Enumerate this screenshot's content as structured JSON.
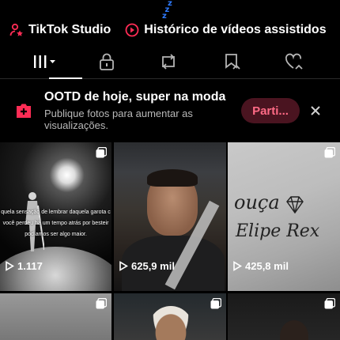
{
  "status": {
    "sleep_glyph": "zzz"
  },
  "shortcuts": [
    {
      "label": "TikTok Studio",
      "icon": "person-star-icon",
      "color": "#fe2c55"
    },
    {
      "label": "Histórico de vídeos assistidos",
      "icon": "play-circle-icon",
      "color": "#fe2c55"
    },
    {
      "label": "",
      "icon": "puzzle-icon",
      "color": "#fe2c55"
    }
  ],
  "tabs": [
    {
      "name": "videos",
      "icon": "grid-icon",
      "active": true
    },
    {
      "name": "private",
      "icon": "lock-icon",
      "active": false
    },
    {
      "name": "reposts",
      "icon": "repost-icon",
      "active": false
    },
    {
      "name": "favorites",
      "icon": "bookmark-hand-icon",
      "active": false
    },
    {
      "name": "liked",
      "icon": "heart-hand-icon",
      "active": false
    }
  ],
  "banner": {
    "title": "OOTD de hoje, super na moda",
    "subtitle": "Publique fotos para aumentar as visualizações.",
    "button": "Parti...",
    "accent": "#fe2c55"
  },
  "videos": [
    {
      "views": "1.117",
      "overlay_text": "quela sensação de lembrar daquela garota c você perdeu há um tempo atrás por besteir podíamos ser algo maior.",
      "multi": true
    },
    {
      "views": "625,9 mil",
      "multi": false
    },
    {
      "views": "425,8 mil",
      "scribble_1": "ouça",
      "scribble_2": "Elipe Rex",
      "multi": true
    },
    {
      "views": "",
      "multi": true
    },
    {
      "views": "",
      "multi": true
    },
    {
      "views": "",
      "multi": true
    }
  ]
}
